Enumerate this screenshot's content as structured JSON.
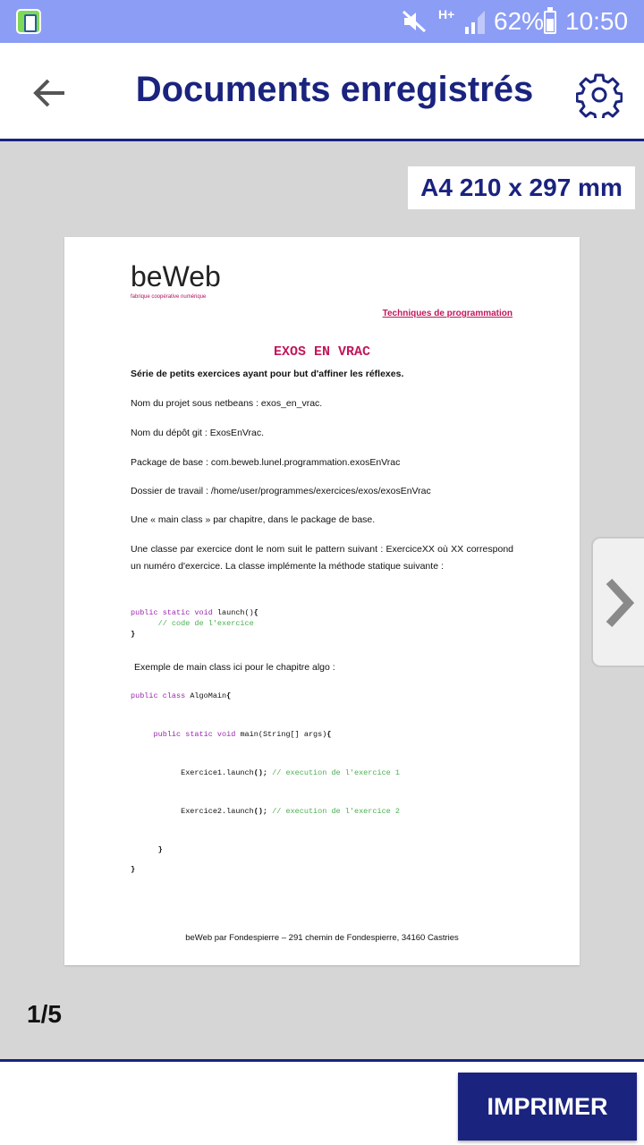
{
  "status_bar": {
    "network": "H+",
    "battery": "62%",
    "time": "10:50"
  },
  "header": {
    "title": "Documents enregistrés"
  },
  "paper_size": "A4 210 x 297 mm",
  "document": {
    "logo": "beWeb",
    "logo_tagline": "fabrique coopérative numérique",
    "header_link": "Techniques de programmation",
    "title": "EXOS EN VRAC",
    "intro": "Série de petits exercices ayant pour but d'affiner les réflexes.",
    "project_name": "Nom du projet sous netbeans : exos_en_vrac.",
    "git_repo": "Nom du dépôt git : ExosEnVrac.",
    "base_package": "Package de base : com.beweb.lunel.programmation.exosEnVrac",
    "work_dir": "Dossier de travail : /home/user/programmes/exercices/exos/exosEnVrac",
    "main_class": "Une « main class » par chapitre, dans le package de base.",
    "class_rule": "Une classe par exercice dont le nom suit le pattern suivant : ExerciceXX où XX correspond un numéro d'exercice. La classe implémente la méthode statique suivante :",
    "code1": {
      "line1_kw": "public static void",
      "line1_rest": " launch()",
      "line1_brace": "{",
      "line2": "// code de l'exercice",
      "line3": "}"
    },
    "example_intro": "Exemple de main class ici pour le chapitre algo :",
    "code2": {
      "l1_kw": "public class",
      "l1_rest": " AlgoMain",
      "l1_brace": "{",
      "l2_kw": "public static void",
      "l2_rest": " main(String[] args)",
      "l2_brace": "{",
      "l3_code": "Exercice1.launch",
      "l3_paren": "();",
      "l3_comment": " // execution de l'exercice 1",
      "l4_code": "Exercice2.launch",
      "l4_paren": "();",
      "l4_comment": " // execution de l'exercice 2",
      "l5": "}",
      "l6": "}"
    },
    "footer": "beWeb par Fondespierre – 291 chemin de Fondespierre, 34160 Castries"
  },
  "pager": "1/5",
  "print_button": "IMPRIMER",
  "icons": {
    "back": "back-arrow-icon",
    "settings": "gear-icon",
    "next": "chevron-right-icon"
  },
  "colors": {
    "primary": "#1a237e",
    "status_bar": "#8c9df5",
    "accent": "#c2185b"
  }
}
